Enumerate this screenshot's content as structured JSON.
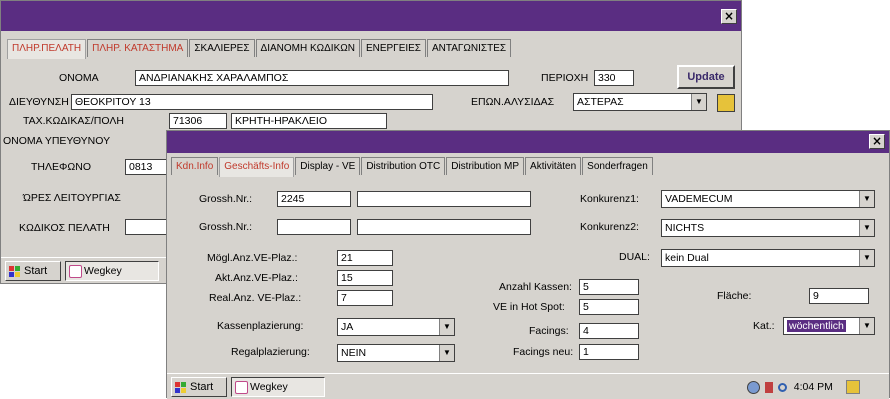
{
  "back_window": {
    "close_label": "×",
    "tabs": [
      "ΠΛΗΡ.ΠΕΛΑΤΗ",
      "ΠΛΗΡ. ΚΑΤΑΣΤΗΜΑ",
      "ΣΚΑΛΙΕΡΕΣ",
      "ΔΙΑΝΟΜΗ ΚΩΔΙΚΩΝ",
      "ΕΝΕΡΓΕΙΕΣ",
      "ΑΝΤΑΓΩΝΙΣΤΕΣ"
    ],
    "fields": {
      "onoma_label": "ΟΝΟΜΑ",
      "onoma_value": "ΑΝΔΡΙΑΝΑΚΗΣ ΧΑΡΑΛΑΜΠΟΣ",
      "periochi_label": "ΠΕΡΙΟΧΗ",
      "periochi_value": "330",
      "update_label": "Update",
      "dieythinsi_label": "ΔΙΕΥΘΥΝΣΗ",
      "dieythinsi_value": "ΘΕΟΚΡΙΤΟΥ 13",
      "epon_label": "ΕΠΩΝ.ΑΛΥΣΙΔΑΣ",
      "epon_value": "ΑΣΤΕΡΑΣ",
      "tk_label": "ΤΑΧ.ΚΩΔΙΚΑΣ/ΠΟΛΗ",
      "tk_value": "71306",
      "poli_value": "ΚΡΗΤΗ-ΗΡΑΚΛΕΙΟ",
      "ypeythynos_label": "ΟΝΟΜΑ ΥΠΕΥΘΥΝΟΥ",
      "tilefono_label": "ΤΗΛΕΦΩΝΟ",
      "tilefono_value": "0813",
      "ores_label": "ΏΡΕΣ ΛΕΙΤΟΥΡΓΙΑΣ",
      "kodikos_label": "ΚΩΔΙΚΟΣ ΠΕΛΑΤΗ"
    },
    "taskbar": {
      "start": "Start",
      "app": "Wegkey"
    }
  },
  "front_window": {
    "close_label": "×",
    "tabs": [
      "Kdn.Info",
      "Geschäfts-Info",
      "Display - VE",
      "Distribution OTC",
      "Distribution MP",
      "Aktivitäten",
      "Sonderfragen"
    ],
    "fields": {
      "grossh1_label": "Grossh.Nr.:",
      "grossh1_value": "2245",
      "grossh2_label": "Grossh.Nr.:",
      "konkurenz1_label": "Konkurenz1:",
      "konkurenz1_value": "VADEMECUM",
      "konkurenz2_label": "Konkurenz2:",
      "konkurenz2_value": "NICHTS",
      "dual_label": "DUAL:",
      "dual_value": "kein Dual",
      "mogl_label": "Mögl.Anz.VE-Plaz.:",
      "mogl_value": "21",
      "akt_label": "Akt.Anz.VE-Plaz.:",
      "akt_value": "15",
      "real_label": "Real.Anz. VE-Plaz.:",
      "real_value": "7",
      "anzahl_label": "Anzahl Kassen:",
      "anzahl_value": "5",
      "hotspot_label": "VE in Hot Spot:",
      "hotspot_value": "5",
      "flache_label": "Fläche:",
      "flache_value": "9",
      "kassen_label": "Kassenplazierung:",
      "kassen_value": "JA",
      "facings_label": "Facings:",
      "facings_value": "4",
      "kat_label": "Kat.:",
      "kat_value": "wöchentlich",
      "regal_label": "Regalplazierung:",
      "regal_value": "NEIN",
      "facingsneu_label": "Facings neu:",
      "facingsneu_value": "1"
    },
    "taskbar": {
      "start": "Start",
      "app": "Wegkey",
      "time": "4:04 PM"
    }
  },
  "colors": {
    "titlebar": "#5a2d82",
    "active_tab": "#c0392b",
    "selection": "#5a2d82"
  }
}
